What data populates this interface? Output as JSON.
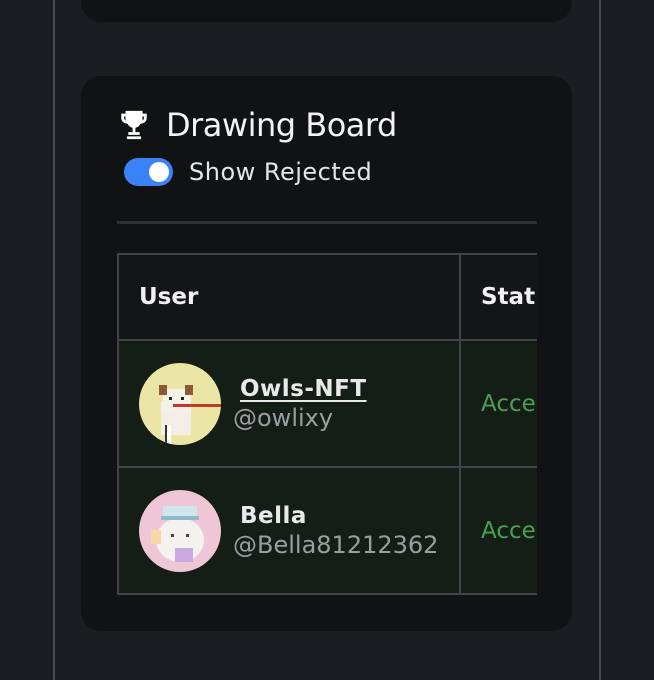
{
  "board": {
    "title": "Drawing Board",
    "icon": "trophy-icon",
    "toggle": {
      "label": "Show Rejected",
      "on": true,
      "color": "#3b82f6"
    }
  },
  "table": {
    "columns": [
      "User",
      "Stat"
    ],
    "rows": [
      {
        "name": "Owls-NFT",
        "handle": "@owlixy",
        "status": "Acce",
        "name_is_link": true
      },
      {
        "name": "Bella",
        "handle": "@Bella81212362",
        "status": "Acce",
        "name_is_link": false
      }
    ]
  },
  "colors": {
    "background": "#1c1d20",
    "card": "#111214",
    "status_accepted": "#4aa04f",
    "row_tint": "#151d17"
  }
}
